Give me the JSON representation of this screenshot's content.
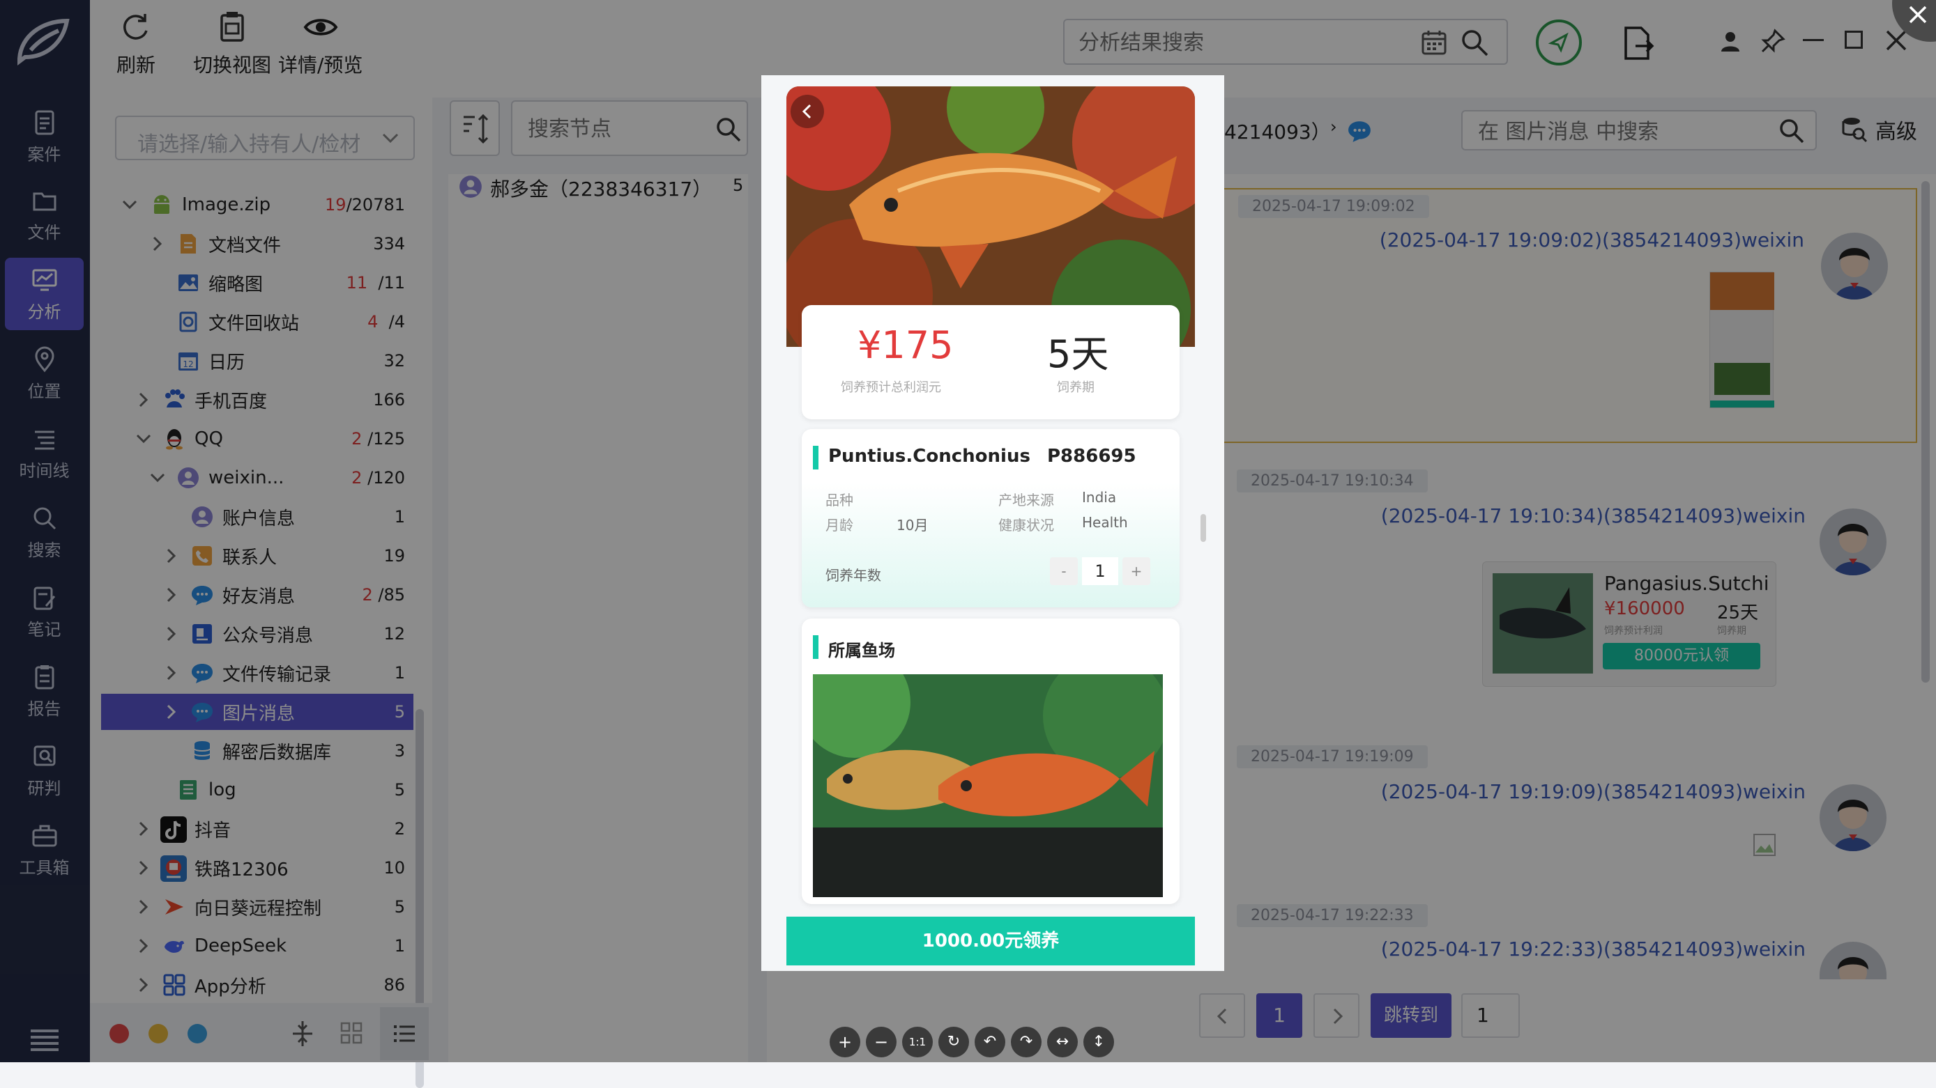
{
  "app": {
    "colors": {
      "accent": "#5a57cf",
      "nav_bg": "#242b46",
      "price_red": "#e23b3b",
      "teal": "#14c9a8"
    }
  },
  "nav": {
    "items": [
      {
        "label": "案件",
        "icon": "case-icon"
      },
      {
        "label": "文件",
        "icon": "folder-icon"
      },
      {
        "label": "分析",
        "icon": "analysis-icon"
      },
      {
        "label": "位置",
        "icon": "location-icon"
      },
      {
        "label": "时间线",
        "icon": "timeline-icon"
      },
      {
        "label": "搜索",
        "icon": "search-icon"
      },
      {
        "label": "笔记",
        "icon": "notes-icon"
      },
      {
        "label": "报告",
        "icon": "report-icon"
      },
      {
        "label": "研判",
        "icon": "judge-icon"
      },
      {
        "label": "工具箱",
        "icon": "toolbox-icon"
      }
    ],
    "active_index": 2
  },
  "toolbar": {
    "refresh": "刷新",
    "switch_view": "切换视图",
    "detail_preview": "详情/预览",
    "search_placeholder": "分析结果搜索"
  },
  "left": {
    "owner_placeholder": "请选择/输入持有人/检材",
    "tree": [
      {
        "label": "Image.zip",
        "count_red": "19",
        "count": "/20781"
      },
      {
        "label": "文档文件",
        "count": "334"
      },
      {
        "label": "缩略图",
        "count_red": "11",
        "count": "/11"
      },
      {
        "label": "文件回收站",
        "count_red": "4",
        "count": "/4"
      },
      {
        "label": "日历",
        "count": "32"
      },
      {
        "label": "手机百度",
        "count": "166"
      },
      {
        "label": "QQ",
        "count_red": "2",
        "count": "/125"
      },
      {
        "label": "weixin...",
        "count_red": "2",
        "count": "/120"
      },
      {
        "label": "账户信息",
        "count": "1"
      },
      {
        "label": "联系人",
        "count": "19"
      },
      {
        "label": "好友消息",
        "count_red": "2",
        "count": "/85"
      },
      {
        "label": "公众号消息",
        "count": "12"
      },
      {
        "label": "文件传输记录",
        "count": "1"
      },
      {
        "label": "图片消息",
        "count": "5"
      },
      {
        "label": "解密后数据库",
        "count": "3"
      },
      {
        "label": "log",
        "count": "5"
      },
      {
        "label": "抖音",
        "count": "2"
      },
      {
        "label": "铁路12306",
        "count": "10"
      },
      {
        "label": "向日葵远程控制",
        "count": "5"
      },
      {
        "label": "DeepSeek",
        "count": "1"
      },
      {
        "label": "App分析",
        "count": "86"
      }
    ]
  },
  "mid": {
    "search_placeholder": "搜索节点",
    "contact": "郝多金（2238346317）",
    "contact_count": "5"
  },
  "right": {
    "breadcrumb_tail": "4214093）",
    "search_placeholder": "在 图片消息 中搜索",
    "advanced": "高级",
    "messages": [
      {
        "ts": "2025-04-17 19:09:02",
        "name": "(2025-04-17 19:09:02)(3854214093)weixin"
      },
      {
        "ts": "2025-04-17 19:10:34",
        "name": "(2025-04-17 19:10:34)(3854214093)weixin"
      },
      {
        "ts": "2025-04-17 19:19:09",
        "name": "(2025-04-17 19:19:09)(3854214093)weixin"
      },
      {
        "ts": "2025-04-17 19:22:33",
        "name": "(2025-04-17 19:22:33)(3854214093)weixin"
      }
    ],
    "card2": {
      "title": "Pangasius.Sutchi",
      "price": "¥160000",
      "days": "25天",
      "sub1": "饲养预计利润",
      "sub2": "饲养期",
      "button": "80000元认领"
    },
    "pagination": {
      "current": "1",
      "jump_label": "跳转到",
      "jump_value": "1"
    }
  },
  "viewer": {
    "price": "¥175",
    "price_sub": "饲养预计总利润元",
    "days": "5天",
    "days_sub": "饲养期",
    "species": "Puntius.Conchonius",
    "code": "P886695",
    "row1_k1": "品种",
    "row1_k2": "产地来源",
    "row1_v2": "India",
    "row2_k1": "月龄",
    "row2_v1": "10月",
    "row2_k2": "健康状况",
    "row2_v2": "Health",
    "years_label": "饲养年数",
    "qty": "1",
    "minus": "-",
    "plus": "+",
    "section2": "所属鱼场",
    "cta": "1000.00元领养",
    "controls": [
      "+",
      "−",
      "1:1",
      "↻",
      "↶",
      "↷",
      "↔",
      "↕"
    ]
  }
}
